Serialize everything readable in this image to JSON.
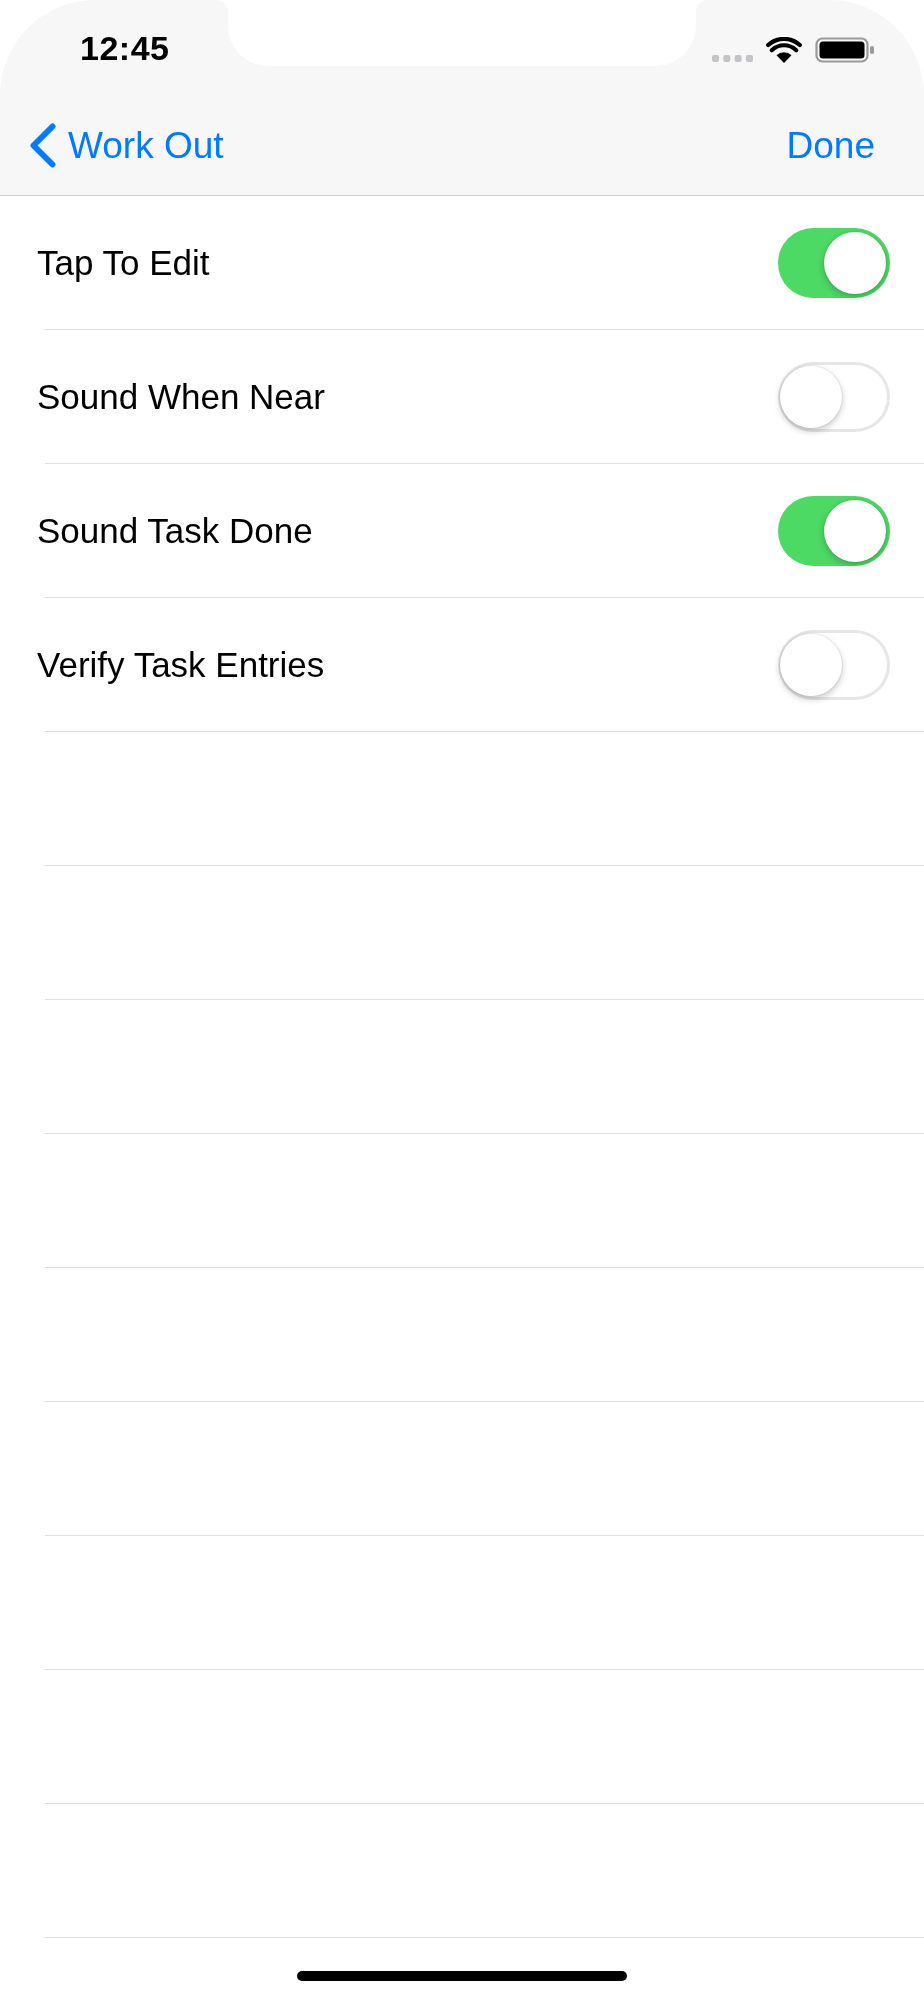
{
  "status_bar": {
    "time": "12:45"
  },
  "nav_bar": {
    "back_label": "Work Out",
    "action_label": "Done"
  },
  "settings": [
    {
      "label": "Tap To Edit",
      "on": true
    },
    {
      "label": "Sound When Near",
      "on": false
    },
    {
      "label": "Sound Task Done",
      "on": true
    },
    {
      "label": "Verify Task Entries",
      "on": false
    }
  ]
}
